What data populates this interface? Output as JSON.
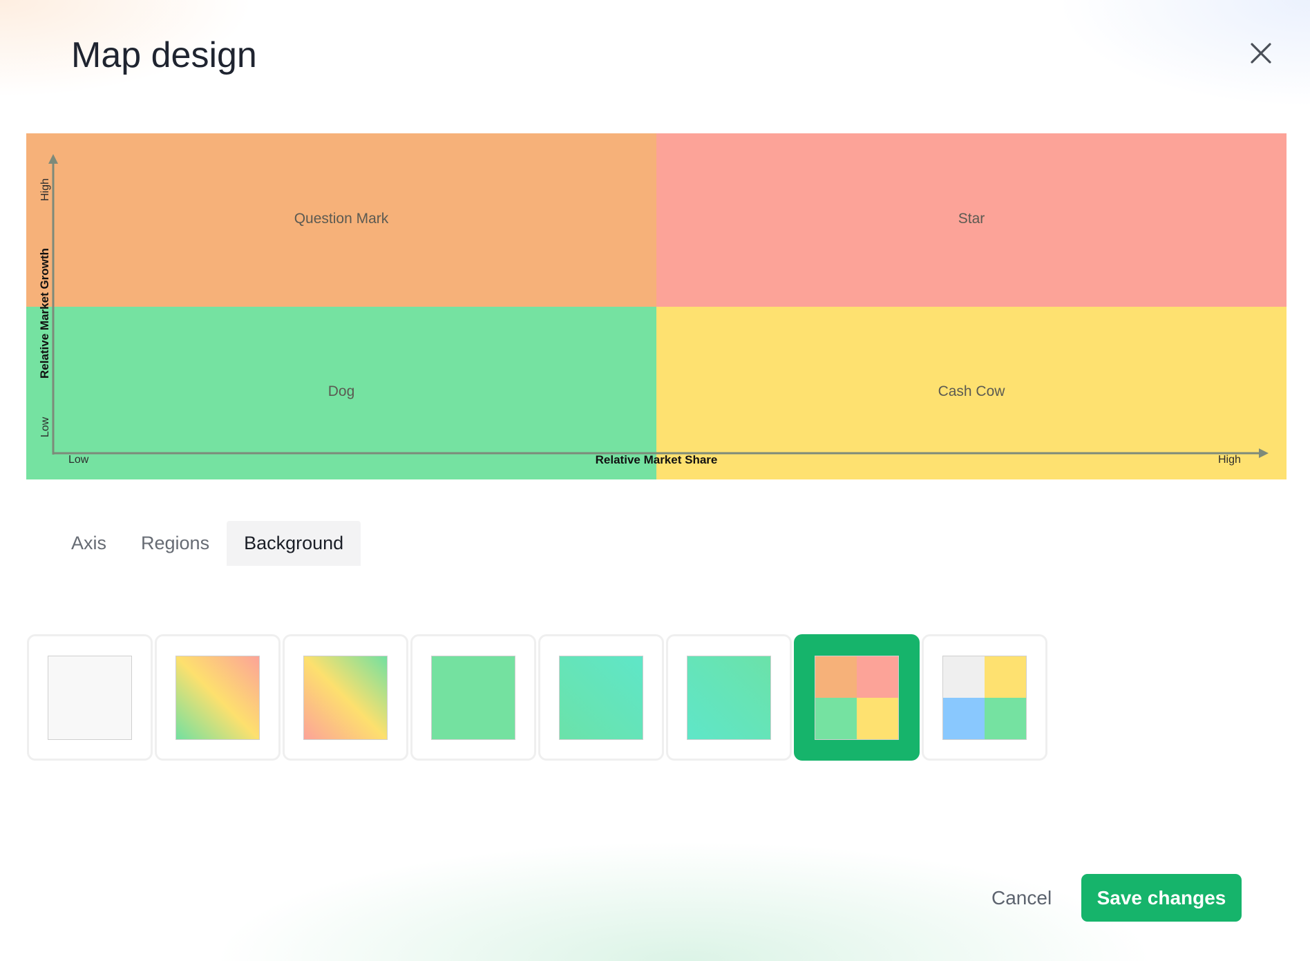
{
  "dialog": {
    "title": "Map design",
    "close_icon": "close-icon"
  },
  "map": {
    "quadrants": {
      "top_left": {
        "label": "Question Mark",
        "color": "#f6b179"
      },
      "top_right": {
        "label": "Star",
        "color": "#fca398"
      },
      "bottom_left": {
        "label": "Dog",
        "color": "#75e2a1"
      },
      "bottom_right": {
        "label": "Cash Cow",
        "color": "#fee170"
      }
    },
    "x_axis": {
      "title": "Relative Market Share",
      "low": "Low",
      "high": "High"
    },
    "y_axis": {
      "title": "Relative Market Growth",
      "low": "Low",
      "high": "High"
    },
    "axis_color": "#7d8a7a"
  },
  "tabs": [
    {
      "label": "Axis",
      "active": false
    },
    {
      "label": "Regions",
      "active": false
    },
    {
      "label": "Background",
      "active": true
    }
  ],
  "backgrounds": {
    "selected_index": 6,
    "options": [
      {
        "kind": "solid",
        "colors": [
          "#f8f8f8"
        ]
      },
      {
        "kind": "gradient",
        "colors": [
          "#73e0a0",
          "#fde06e",
          "#fca398"
        ]
      },
      {
        "kind": "gradient",
        "colors": [
          "#fca398",
          "#fde06e",
          "#73e0a0"
        ]
      },
      {
        "kind": "solid",
        "colors": [
          "#74e1a0"
        ]
      },
      {
        "kind": "gradient",
        "colors": [
          "#6be2a9",
          "#5fe6c8"
        ]
      },
      {
        "kind": "gradient",
        "colors": [
          "#5fe6c8",
          "#6be2a9"
        ]
      },
      {
        "kind": "quad",
        "colors": [
          "#f6b179",
          "#fca398",
          "#75e2a1",
          "#fee170"
        ]
      },
      {
        "kind": "quad",
        "colors": [
          "#efefef",
          "#fee170",
          "#89c8fe",
          "#75e2a1"
        ]
      }
    ]
  },
  "footer": {
    "cancel_label": "Cancel",
    "save_label": "Save changes",
    "accent": "#16b46b"
  }
}
